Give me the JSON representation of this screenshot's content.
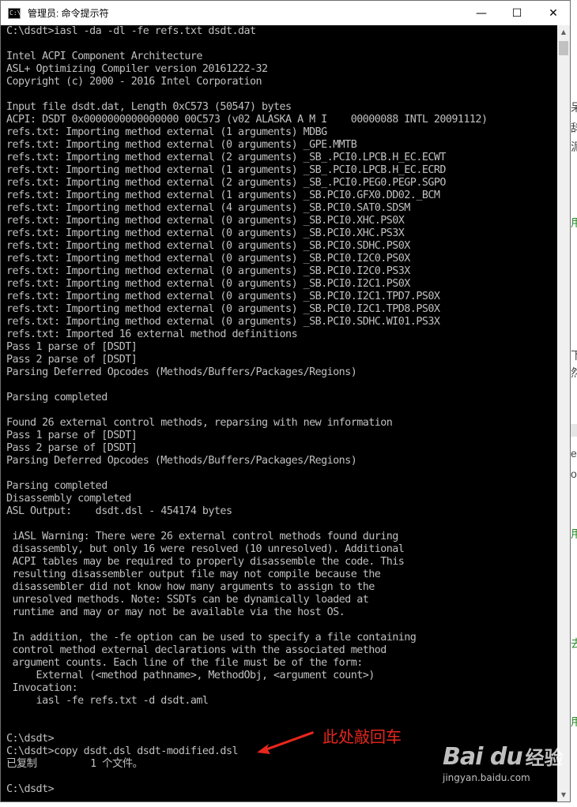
{
  "window": {
    "title": "管理员: 命令提示符",
    "icon_label": "C:\\",
    "minimize_glyph": "—",
    "maximize_glyph": "☐",
    "close_glyph": "✕"
  },
  "console_lines": [
    "C:\\dsdt>iasl -da -dl -fe refs.txt dsdt.dat",
    "",
    "Intel ACPI Component Architecture",
    "ASL+ Optimizing Compiler version 20161222-32",
    "Copyright (c) 2000 - 2016 Intel Corporation",
    "",
    "Input file dsdt.dat, Length 0xC573 (50547) bytes",
    "ACPI: DSDT 0x0000000000000000 00C573 (v02 ALASKA A M I    00000088 INTL 20091112)",
    "refs.txt: Importing method external (1 arguments) MDBG",
    "refs.txt: Importing method external (0 arguments) _GPE.MMTB",
    "refs.txt: Importing method external (2 arguments) _SB_.PCI0.LPCB.H_EC.ECWT",
    "refs.txt: Importing method external (1 arguments) _SB_.PCI0.LPCB.H_EC.ECRD",
    "refs.txt: Importing method external (2 arguments) _SB_.PCI0.PEG0.PEGP.SGPO",
    "refs.txt: Importing method external (1 arguments) _SB.PCI0.GFX0.DD02._BCM",
    "refs.txt: Importing method external (4 arguments) _SB.PCI0.SAT0.SDSM",
    "refs.txt: Importing method external (0 arguments) _SB.PCI0.XHC.PS0X",
    "refs.txt: Importing method external (0 arguments) _SB.PCI0.XHC.PS3X",
    "refs.txt: Importing method external (0 arguments) _SB.PCI0.SDHC.PS0X",
    "refs.txt: Importing method external (0 arguments) _SB.PCI0.I2C0.PS0X",
    "refs.txt: Importing method external (0 arguments) _SB.PCI0.I2C0.PS3X",
    "refs.txt: Importing method external (0 arguments) _SB.PCI0.I2C1.PS0X",
    "refs.txt: Importing method external (0 arguments) _SB.PCI0.I2C1.TPD7.PS0X",
    "refs.txt: Importing method external (0 arguments) _SB.PCI0.I2C1.TPD8.PS0X",
    "refs.txt: Importing method external (0 arguments) _SB.PCI0.SDHC.WI01.PS3X",
    "refs.txt: Imported 16 external method definitions",
    "Pass 1 parse of [DSDT]",
    "Pass 2 parse of [DSDT]",
    "Parsing Deferred Opcodes (Methods/Buffers/Packages/Regions)",
    "",
    "Parsing completed",
    "",
    "Found 26 external control methods, reparsing with new information",
    "Pass 1 parse of [DSDT]",
    "Pass 2 parse of [DSDT]",
    "Parsing Deferred Opcodes (Methods/Buffers/Packages/Regions)",
    "",
    "Parsing completed",
    "Disassembly completed",
    "ASL Output:    dsdt.dsl - 454174 bytes",
    "",
    " iASL Warning: There were 26 external control methods found during",
    " disassembly, but only 16 were resolved (10 unresolved). Additional",
    " ACPI tables may be required to properly disassemble the code. This",
    " resulting disassembler output file may not compile because the",
    " disassembler did not know how many arguments to assign to the",
    " unresolved methods. Note: SSDTs can be dynamically loaded at",
    " runtime and may or may not be available via the host OS.",
    "",
    " In addition, the -fe option can be used to specify a file containing",
    " control method external declarations with the associated method",
    " argument counts. Each line of the file must be of the form:",
    "     External (<method pathname>, MethodObj, <argument count>)",
    " Invocation:",
    "     iasl -fe refs.txt -d dsdt.aml",
    "",
    "",
    "C:\\dsdt>",
    "C:\\dsdt>copy dsdt.dsl dsdt-modified.dsl",
    "已复制         1 个文件。",
    "",
    "C:\\dsdt>"
  ],
  "annotation": {
    "text": "此处敲回车",
    "color": "#e8261c"
  },
  "watermark": {
    "logo": "Bai du",
    "label": "经验",
    "url": "jingyan.baidu.com"
  },
  "colors": {
    "console_bg": "#000000",
    "console_text": "#c0c0c0",
    "titlebar_bg": "#ffffff"
  },
  "side_fragments": [
    "呆",
    "辞",
    "泥",
    "用",
    "下",
    "然",
    "e",
    "o",
    "用",
    "去",
    "用"
  ]
}
